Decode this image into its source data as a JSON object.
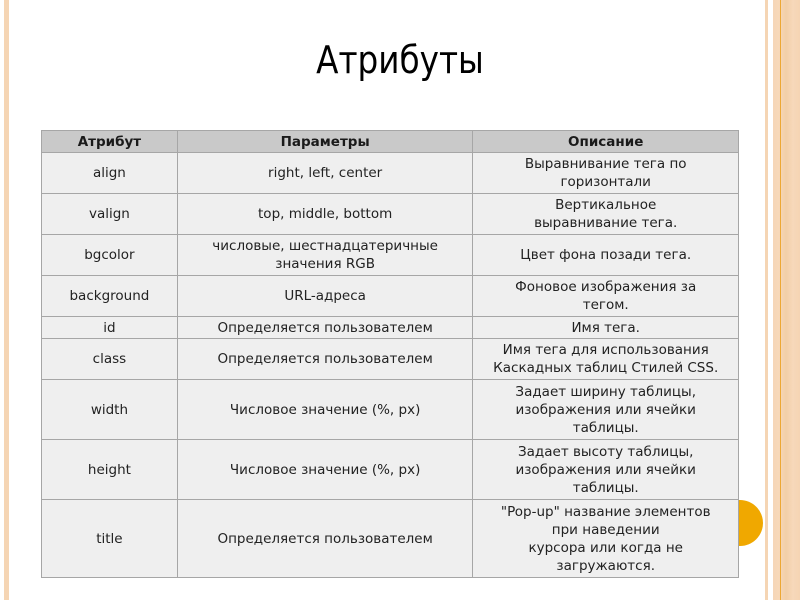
{
  "slide": {
    "title": "Атрибуты",
    "colors": {
      "accent_orange": "#f0a800",
      "border_peach": "#f5d5b4",
      "header_bg": "#c9c9c9",
      "cell_bg": "#efefef",
      "grid": "#a6a6a6"
    }
  },
  "table": {
    "headers": [
      "Атрибут",
      "Параметры",
      "Описание"
    ],
    "rows": [
      {
        "attribute": "align",
        "params": "right, left, center",
        "description": [
          "Выравнивание тега по",
          "горизонтали"
        ]
      },
      {
        "attribute": "valign",
        "params": "top, middle, bottom",
        "description": [
          "Вертикальное",
          "выравнивание тега."
        ]
      },
      {
        "attribute": "bgcolor",
        "params": [
          "числовые, шестнадцатеричные",
          "значения RGB"
        ],
        "description": [
          "Цвет фона позади тега."
        ]
      },
      {
        "attribute": "background",
        "params": "URL-адреса",
        "description": [
          "Фоновое изображения за",
          "тегом."
        ]
      },
      {
        "attribute": "id",
        "params": "Определяется пользователем",
        "description": [
          "Имя тега."
        ]
      },
      {
        "attribute": "class",
        "params": "Определяется пользователем",
        "description": [
          "Имя тега для использования",
          "Каскадных таблиц Стилей CSS."
        ]
      },
      {
        "attribute": "width",
        "params": "Числовое значение (%, px)",
        "description": [
          "Задает ширину таблицы,",
          "изображения или ячейки",
          "таблицы."
        ]
      },
      {
        "attribute": "height",
        "params": "Числовое значение (%, px)",
        "description": [
          "Задает высоту таблицы,",
          "изображения или ячейки",
          "таблицы."
        ]
      },
      {
        "attribute": "title",
        "params": "Определяется пользователем",
        "description": [
          "\"Pop-up\" название элементов",
          "при наведении",
          "курсора или когда не",
          "загружаются."
        ]
      }
    ]
  }
}
